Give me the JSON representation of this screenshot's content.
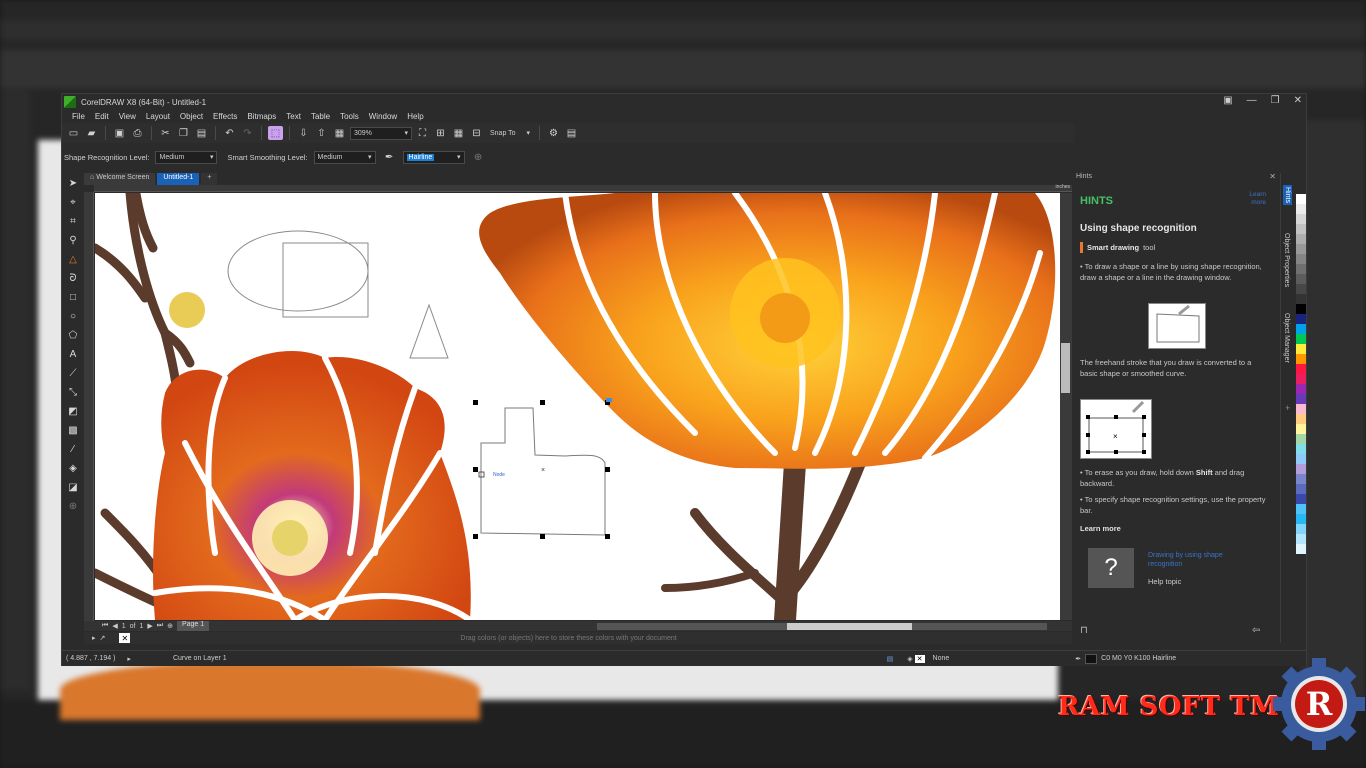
{
  "window": {
    "title": "CorelDRAW X8 (64-Bit) - Untitled-1",
    "controls": [
      "▣",
      "—",
      "❐",
      "✕"
    ]
  },
  "menu": [
    "File",
    "Edit",
    "View",
    "Layout",
    "Object",
    "Effects",
    "Bitmaps",
    "Text",
    "Table",
    "Tools",
    "Window",
    "Help"
  ],
  "toolbar": {
    "zoom": "309%",
    "snap_to": "Snap To"
  },
  "property_bar": {
    "shape_recognition_label": "Shape Recognition Level:",
    "shape_recognition_value": "Medium",
    "smart_smoothing_label": "Smart Smoothing Level:",
    "smart_smoothing_value": "Medium",
    "outline_width": "Hairline"
  },
  "doc_tabs": [
    "Welcome Screen",
    "Untitled-1"
  ],
  "ruler_unit": "inches",
  "canvas": {
    "node_label": "Node"
  },
  "page_nav": {
    "current": "1",
    "of": "of",
    "total": "1",
    "page_tab": "Page 1"
  },
  "color_well_hint": "Drag colors (or objects) here to store these colors with your document",
  "status": {
    "coords": "( 4.887 , 7.194 )",
    "object_info": "Curve on Layer 1",
    "fill": "None",
    "outline": "C0 M0 Y0 K100  Hairline"
  },
  "hints_docker": {
    "header": "Hints",
    "title": "HINTS",
    "learn_more_top": "Learn more",
    "subtitle": "Using shape recognition",
    "tool_name": "Smart drawing",
    "tool_suffix": "tool",
    "p1": "• To draw a shape or a line by using shape recognition, draw a shape or a line in the drawing window.",
    "p2": "The freehand stroke that you draw is converted to a basic shape or smoothed curve.",
    "p3a": "• To erase as you draw, hold down ",
    "p3b": "Shift",
    "p3c": " and drag backward.",
    "p4": "• To specify shape recognition settings, use the property bar.",
    "learn_more": "Learn more",
    "help_link": "Drawing by using shape recognition",
    "help_topic": "Help topic",
    "help_icon": "?"
  },
  "side_tabs": [
    "Hints",
    "Object Properties",
    "Object Manager"
  ],
  "palette": [
    "#ffffff",
    "#ebebeb",
    "#d6d6d6",
    "#c2c2c2",
    "#adadad",
    "#999999",
    "#858585",
    "#707070",
    "#5c5c5c",
    "#474747",
    "#333333",
    "#000000",
    "#1a237e",
    "#00a2e8",
    "#00c853",
    "#ffeb3b",
    "#ff9800",
    "#ff1744",
    "#e91e63",
    "#9c27b0",
    "#673ab7",
    "#f8bbd0",
    "#ffcc80",
    "#fff59d",
    "#a5d6a7",
    "#80deea",
    "#90caf9",
    "#b39ddb",
    "#7986cb",
    "#5c6bc0",
    "#3949ab",
    "#4fc3f7",
    "#29b6f6",
    "#81d4fa",
    "#b3e5fc",
    "#e1f5fe"
  ],
  "colors": {
    "accent_blue": "#1a62b8",
    "hints_green": "#48c066",
    "brand_red": "#ff2a1a"
  },
  "watermark": {
    "text": "RAM SOFT TM",
    "logo_letter": "R"
  }
}
